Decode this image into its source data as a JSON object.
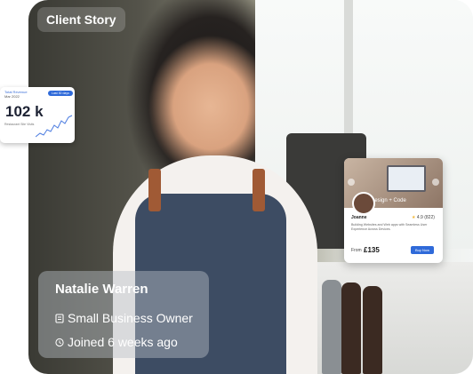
{
  "hero": {
    "badge": "Client Story"
  },
  "stat_card": {
    "label": "Total Revenue",
    "period": "Mar 2022",
    "pill": "Last 30 days",
    "value": "102 k",
    "caption": "Restaurant Site Visits"
  },
  "product_card": {
    "cover_tag": "Design + Code",
    "seller_name": "Joanne",
    "rating": "4.9",
    "rating_count": "(822)",
    "description": "Building Websites and Web apps with Seamless User Experience Across Devices.",
    "price_label": "From",
    "price": "£135",
    "buy_label": "Buy Now"
  },
  "person": {
    "name": "Natalie Warren",
    "role": "Small Business Owner",
    "joined": "Joined 6 weeks ago"
  }
}
